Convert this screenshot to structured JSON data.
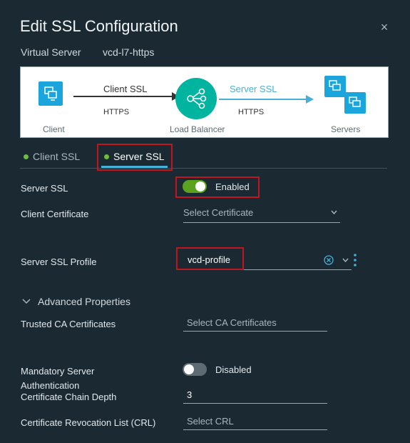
{
  "dialog": {
    "title": "Edit SSL Configuration",
    "close_symbol": "×",
    "virtual_server_label": "Virtual Server",
    "virtual_server_value": "vcd-l7-https"
  },
  "diagram": {
    "client_label": "Client",
    "load_balancer_label": "Load Balancer",
    "servers_label": "Servers",
    "client_ssl_label": "Client SSL",
    "server_ssl_label": "Server SSL",
    "client_protocol": "HTTPS",
    "server_protocol": "HTTPS"
  },
  "tabs": [
    {
      "label": "Client SSL",
      "active": false
    },
    {
      "label": "Server SSL",
      "active": true
    }
  ],
  "form": {
    "server_ssl": {
      "label": "Server SSL",
      "state": "Enabled",
      "on": true
    },
    "client_certificate": {
      "label": "Client Certificate",
      "placeholder": "Select Certificate"
    },
    "server_ssl_profile": {
      "label": "Server SSL Profile",
      "value": "vcd-profile"
    },
    "advanced_properties_label": "Advanced Properties",
    "trusted_ca": {
      "label": "Trusted CA Certificates",
      "placeholder": "Select CA Certificates"
    },
    "mandatory_auth": {
      "label_line1": "Mandatory Server",
      "label_line2": "Authentication",
      "state": "Disabled",
      "on": false
    },
    "chain_depth": {
      "label": "Certificate Chain Depth",
      "value": "3"
    },
    "crl": {
      "label": "Certificate Revocation List (CRL)",
      "placeholder": "Select CRL"
    }
  },
  "colors": {
    "background": "#1b2a32",
    "accent_blue": "#49afd9",
    "toggle_on": "#5aa220",
    "highlight_red": "#c0161e",
    "diagram_blue": "#1aa5dc",
    "load_balancer_teal": "#00b4a0"
  }
}
